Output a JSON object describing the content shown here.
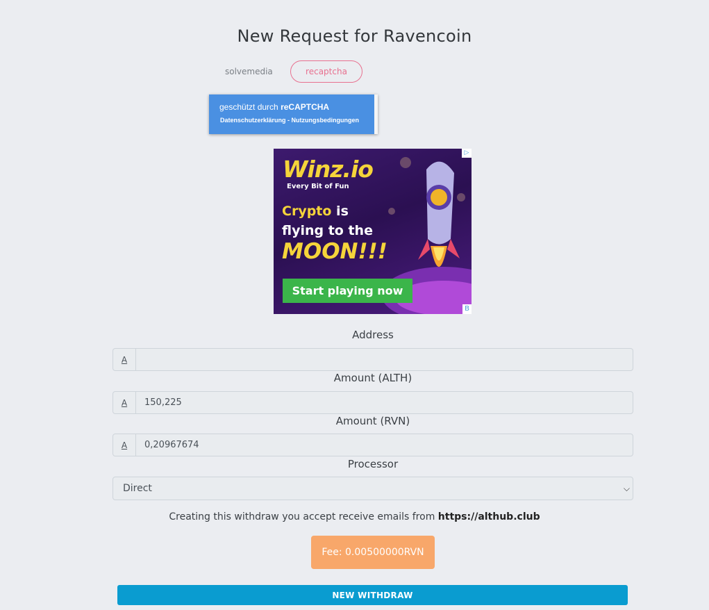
{
  "page": {
    "title": "New Request for Ravencoin"
  },
  "captcha_tabs": [
    {
      "label": "solvemedia",
      "active": false
    },
    {
      "label": "recaptcha",
      "active": true
    }
  ],
  "recaptcha": {
    "line1_prefix": "geschützt durch ",
    "line1_brand": "reCAPTCHA",
    "line2": "Datenschutzerklärung - Nutzungsbedingungen"
  },
  "ad": {
    "logo": "Winz.io",
    "tagline": "Every Bit of Fun",
    "headline_highlight": "Crypto",
    "headline_rest1": " is",
    "headline_line2": "flying to the",
    "headline_line3": "MOON!!!",
    "cta": "Start playing now",
    "adchoice_icon": "▷",
    "badge": "B"
  },
  "form": {
    "address": {
      "label": "Address",
      "icon": "A",
      "value": ""
    },
    "amount_alth": {
      "label": "Amount (ALTH)",
      "icon": "A",
      "value": "150,225"
    },
    "amount_rvn": {
      "label": "Amount (RVN)",
      "icon": "A",
      "value": "0,20967674"
    },
    "processor": {
      "label": "Processor",
      "selected": "Direct"
    }
  },
  "notice": {
    "text": "Creating this withdraw you accept receive emails from ",
    "link": "https://althub.club"
  },
  "fee": {
    "label": "Fee: 0.00500000RVN"
  },
  "submit": {
    "label": "NEW WITHDRAW"
  },
  "colors": {
    "accent_pink": "#e8708f",
    "fee_orange": "#f8a76a",
    "submit_blue": "#0a9cd0",
    "recaptcha_blue": "#4a90e2"
  }
}
